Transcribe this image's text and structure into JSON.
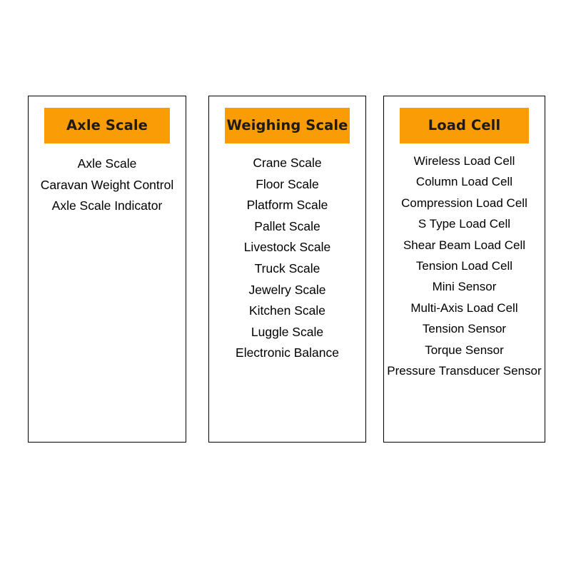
{
  "theme": {
    "page_background": "#ffffff",
    "card_background": "#ffffff",
    "card_border": "#000000",
    "header_background": "#fa9c05",
    "header_text": "#1f1a16",
    "list_text": "#000000"
  },
  "columns": [
    {
      "id": "axle-scale",
      "header": "Axle Scale",
      "items": [
        "Axle Scale",
        "Caravan Weight Control",
        "Axle Scale Indicator"
      ]
    },
    {
      "id": "weighing-scale",
      "header": "Weighing Scale",
      "items": [
        "Crane Scale",
        "Floor Scale",
        "Platform Scale",
        "Pallet Scale",
        "Livestock Scale",
        "Truck Scale",
        "Jewelry Scale",
        "Kitchen Scale",
        "Luggle Scale",
        "Electronic Balance"
      ]
    },
    {
      "id": "load-cell",
      "header": "Load Cell",
      "items": [
        "Wireless Load Cell",
        "Column Load Cell",
        "Compression Load Cell",
        "S Type Load Cell",
        "Shear Beam Load Cell",
        "Tension Load Cell",
        "Mini Sensor",
        "Multi-Axis Load Cell",
        "Tension Sensor",
        "Torque Sensor",
        "Pressure Transducer Sensor"
      ]
    }
  ]
}
